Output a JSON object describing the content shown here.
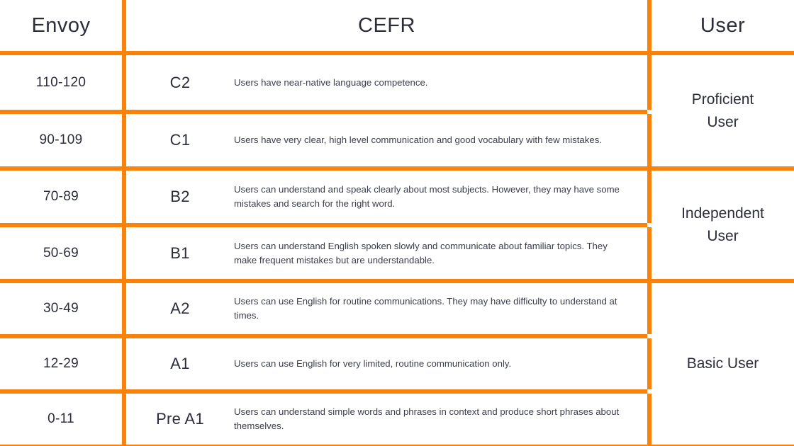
{
  "table": {
    "accent_color": "#f9820b",
    "text_color": "#2b2d3a",
    "background_color": "#ffffff",
    "headers": {
      "envoy": "Envoy",
      "cefr": "CEFR",
      "user": "User"
    },
    "rows": [
      {
        "envoy": "110-120",
        "level": "C2",
        "description": "Users have near-native language competence."
      },
      {
        "envoy": "90-109",
        "level": "C1",
        "description": "Users have very clear, high level communication and good vocabulary with few mistakes."
      },
      {
        "envoy": "70-89",
        "level": "B2",
        "description": "Users can understand and speak clearly about most subjects. However, they may have some mistakes and search for the right word."
      },
      {
        "envoy": "50-69",
        "level": "B1",
        "description": "Users can understand English spoken slowly and communicate about familiar topics. They make frequent mistakes but are understandable."
      },
      {
        "envoy": "30-49",
        "level": "A2",
        "description": "Users can use English for routine communications. They may have difficulty to understand at times."
      },
      {
        "envoy": "12-29",
        "level": "A1",
        "description": "Users can use English for very limited, routine communication only."
      },
      {
        "envoy": "0-11",
        "level": "Pre A1",
        "description": "Users can understand simple words and phrases in context and produce short phrases about themselves."
      }
    ],
    "user_groups": [
      {
        "line1": "Proficient",
        "line2": "User"
      },
      {
        "line1": "Independent",
        "line2": "User"
      },
      {
        "line1": "Basic User",
        "line2": ""
      }
    ]
  }
}
